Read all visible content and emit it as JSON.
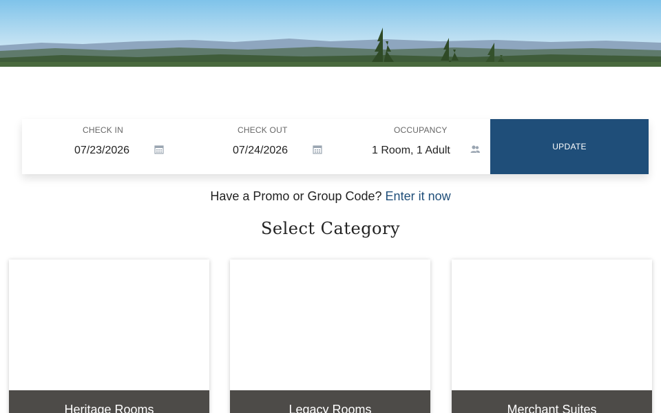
{
  "booking": {
    "check_in": {
      "label": "CHECK IN",
      "value": "07/23/2026",
      "icon": "calendar-icon"
    },
    "check_out": {
      "label": "CHECK OUT",
      "value": "07/24/2026",
      "icon": "calendar-icon"
    },
    "occupancy": {
      "label": "OCCUPANCY",
      "value": "1 Room, 1 Adult",
      "icon": "users-icon"
    },
    "update_label": "UPDATE"
  },
  "promo": {
    "text": "Have a Promo or Group Code?",
    "link": "Enter it now"
  },
  "category_title": "Select Category",
  "categories": [
    {
      "name": "Heritage Rooms"
    },
    {
      "name": "Legacy Rooms"
    },
    {
      "name": "Merchant Suites"
    }
  ],
  "colors": {
    "accent": "#1f4e79",
    "card_footer": "#4d4b48"
  }
}
